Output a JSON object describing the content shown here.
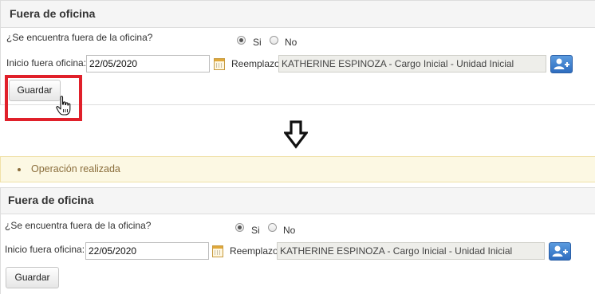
{
  "section_title": "Fuera de oficina",
  "question": "¿Se encuentra fuera de la oficina?",
  "radio_si": "Si",
  "radio_no": "No",
  "start_label": "Inicio fuera oficina:",
  "start_value": "22/05/2020",
  "replacement_label": "Reemplazo",
  "replacement_value": "KATHERINE ESPINOZA - Cargo Inicial - Unidad Inicial",
  "save_label": "Guardar",
  "alert_message": "Operación realizada",
  "colors": {
    "highlight": "#e0202a",
    "alert_bg": "#fcf8e3",
    "alert_text": "#8a6d3b",
    "accent_button": "#3a7bd5"
  },
  "icons": [
    "calendar-icon",
    "add-user-icon",
    "hand-cursor-icon",
    "down-arrow-icon"
  ]
}
